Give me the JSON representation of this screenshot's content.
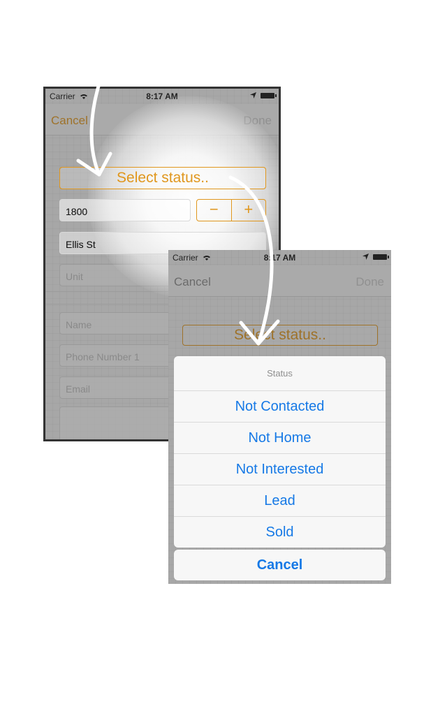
{
  "colors": {
    "accent": "#e0971e",
    "link_blue": "#1679e6",
    "muted": "#c8c8c8"
  },
  "back_screen": {
    "statusbar": {
      "carrier": "Carrier",
      "time": "8:17 AM"
    },
    "nav": {
      "cancel": "Cancel",
      "done": "Done"
    },
    "select_status": "Select status..",
    "street_number": "1800",
    "stepper": {
      "minus": "−",
      "plus": "+"
    },
    "street_name": "Ellis St",
    "unit_placeholder": "Unit",
    "name_placeholder": "Name",
    "phone_placeholder": "Phone Number 1",
    "email_placeholder": "Email"
  },
  "front_screen": {
    "statusbar": {
      "carrier": "Carrier",
      "time": "8:17 AM"
    },
    "nav": {
      "cancel": "Cancel",
      "done": "Done"
    },
    "select_status": "Select status..",
    "action_sheet": {
      "title": "Status",
      "options": [
        "Not Contacted",
        "Not Home",
        "Not Interested",
        "Lead",
        "Sold"
      ],
      "cancel": "Cancel"
    }
  }
}
